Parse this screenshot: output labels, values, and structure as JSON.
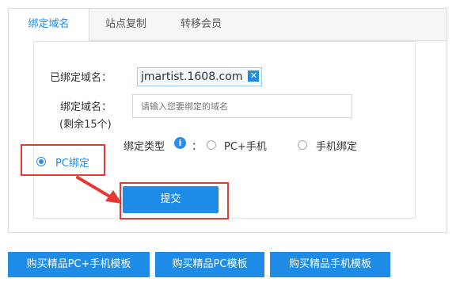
{
  "tabs": [
    {
      "label": "绑定域名",
      "active": true
    },
    {
      "label": "站点复制",
      "active": false
    },
    {
      "label": "转移会员",
      "active": false
    }
  ],
  "form": {
    "bound_label": "已绑定域名：",
    "bound_domain": "jmartist.1608.com",
    "bind_label": "绑定域名：",
    "remaining": "(剩余15个)",
    "input_placeholder": "请输入您要绑定的域名",
    "input_value": "",
    "type_label": "绑定类型",
    "type_colon": "：",
    "options": [
      {
        "label": "PC+手机",
        "checked": false
      },
      {
        "label": "手机绑定",
        "checked": false
      },
      {
        "label": "PC绑定",
        "checked": true
      }
    ],
    "submit": "提交"
  },
  "buy_buttons": [
    "购买精品PC+手机模板",
    "购买精品PC模板",
    "购买精品手机模板"
  ],
  "colors": {
    "accent": "#1e8ce6",
    "highlight": "#e53935"
  }
}
